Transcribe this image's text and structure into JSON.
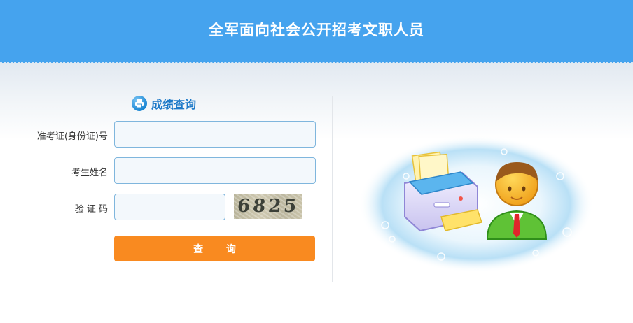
{
  "header": {
    "title": "全军面向社会公开招考文职人员"
  },
  "section": {
    "title": "成绩查询",
    "icon": "printer-icon"
  },
  "form": {
    "exam_id_label": "准考证(身份证)号",
    "exam_id_value": "",
    "name_label": "考生姓名",
    "name_value": "",
    "captcha_label": "验 证 码",
    "captcha_value": "",
    "captcha_image_text": "6825"
  },
  "button": {
    "query_label": "查 询"
  },
  "colors": {
    "header_bg": "#45a3ee",
    "title_blue": "#1d79c8",
    "button_orange": "#f98a20",
    "input_border": "#7fb6dd"
  },
  "illustration": {
    "icon": "printer-user-illustration"
  }
}
